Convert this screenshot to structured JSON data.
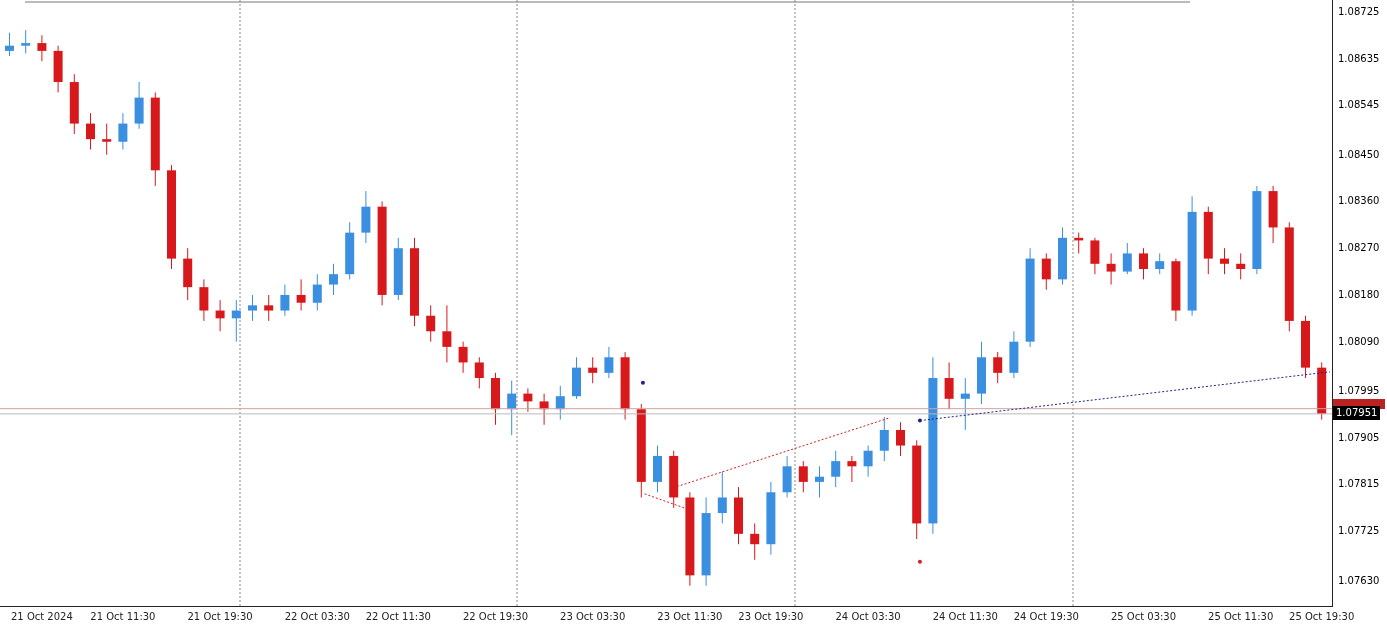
{
  "chart_data": {
    "type": "candlestick",
    "categories": [
      null,
      null,
      "21 Oct 2024",
      null,
      null,
      null,
      null,
      "21 Oct 11:30",
      null,
      null,
      null,
      null,
      null,
      "21 Oct 19:30",
      null,
      null,
      null,
      null,
      null,
      "22 Oct 03:30",
      null,
      null,
      null,
      null,
      "22 Oct 11:30",
      null,
      null,
      null,
      null,
      null,
      "22 Oct 19:30",
      null,
      null,
      null,
      null,
      null,
      "23 Oct 03:30",
      null,
      null,
      null,
      null,
      null,
      "23 Oct 11:30",
      null,
      null,
      null,
      null,
      "23 Oct 19:30",
      null,
      null,
      null,
      null,
      null,
      "24 Oct 03:30",
      null,
      null,
      null,
      null,
      null,
      "24 Oct 11:30",
      null,
      null,
      null,
      null,
      "24 Oct 19:30",
      null,
      null,
      null,
      null,
      null,
      "25 Oct 03:30",
      null,
      null,
      null,
      null,
      null,
      "25 Oct 11:30",
      null,
      null,
      null,
      null,
      "25 Oct 19:30"
    ],
    "ohlc": [
      [
        1.0865,
        1.08685,
        1.0864,
        1.0866
      ],
      [
        1.0866,
        1.0869,
        1.08645,
        1.08665
      ],
      [
        1.08665,
        1.0868,
        1.0863,
        1.0865
      ],
      [
        1.0865,
        1.0866,
        1.0857,
        1.0859
      ],
      [
        1.0859,
        1.08605,
        1.0849,
        1.0851
      ],
      [
        1.0851,
        1.0853,
        1.0846,
        1.0848
      ],
      [
        1.0848,
        1.0851,
        1.0845,
        1.08475
      ],
      [
        1.08475,
        1.0853,
        1.0846,
        1.0851
      ],
      [
        1.0851,
        1.0859,
        1.085,
        1.0856
      ],
      [
        1.0856,
        1.0857,
        1.0839,
        1.0842
      ],
      [
        1.0842,
        1.0843,
        1.0823,
        1.0825
      ],
      [
        1.0825,
        1.0827,
        1.0817,
        1.08195
      ],
      [
        1.08195,
        1.0821,
        1.0813,
        1.0815
      ],
      [
        1.0815,
        1.0817,
        1.0811,
        1.08135
      ],
      [
        1.08135,
        1.0817,
        1.0809,
        1.0815
      ],
      [
        1.0815,
        1.0818,
        1.0813,
        1.0816
      ],
      [
        1.0816,
        1.0818,
        1.0813,
        1.0815
      ],
      [
        1.0815,
        1.082,
        1.0814,
        1.0818
      ],
      [
        1.0818,
        1.0821,
        1.0815,
        1.08165
      ],
      [
        1.08165,
        1.0822,
        1.0815,
        1.082
      ],
      [
        1.082,
        1.0824,
        1.0818,
        1.0822
      ],
      [
        1.0822,
        1.0832,
        1.0821,
        1.083
      ],
      [
        1.083,
        1.0838,
        1.0828,
        1.0835
      ],
      [
        1.0835,
        1.0836,
        1.0816,
        1.0818
      ],
      [
        1.0818,
        1.0829,
        1.0817,
        1.0827
      ],
      [
        1.0827,
        1.0829,
        1.0812,
        1.0814
      ],
      [
        1.0814,
        1.0816,
        1.0809,
        1.0811
      ],
      [
        1.0811,
        1.0816,
        1.0805,
        1.0808
      ],
      [
        1.0808,
        1.0809,
        1.0803,
        1.0805
      ],
      [
        1.0805,
        1.0806,
        1.08,
        1.0802
      ],
      [
        1.0802,
        1.0803,
        1.0793,
        1.0796
      ],
      [
        1.0796,
        1.08015,
        1.0791,
        1.0799
      ],
      [
        1.0799,
        1.08,
        1.07955,
        1.07975
      ],
      [
        1.07975,
        1.0799,
        1.0793,
        1.0796
      ],
      [
        1.0796,
        1.08005,
        1.0794,
        1.07985
      ],
      [
        1.07985,
        1.0806,
        1.0798,
        1.0804
      ],
      [
        1.0804,
        1.0806,
        1.0801,
        1.0803
      ],
      [
        1.0803,
        1.0808,
        1.0802,
        1.0806
      ],
      [
        1.0806,
        1.0807,
        1.0794,
        1.0796
      ],
      [
        1.0796,
        1.0797,
        1.0779,
        1.0782
      ],
      [
        1.0782,
        1.0789,
        1.078,
        1.0787
      ],
      [
        1.0787,
        1.0788,
        1.0777,
        1.0779
      ],
      [
        1.0779,
        1.078,
        1.0762,
        1.0764
      ],
      [
        1.0764,
        1.0779,
        1.0762,
        1.0776
      ],
      [
        1.0776,
        1.0784,
        1.0774,
        1.0779
      ],
      [
        1.0779,
        1.0781,
        1.077,
        1.0772
      ],
      [
        1.0772,
        1.0774,
        1.0767,
        1.077
      ],
      [
        1.077,
        1.0782,
        1.0768,
        1.078
      ],
      [
        1.078,
        1.0787,
        1.0779,
        1.0785
      ],
      [
        1.0785,
        1.0786,
        1.078,
        1.0782
      ],
      [
        1.0782,
        1.0785,
        1.0779,
        1.0783
      ],
      [
        1.0783,
        1.0788,
        1.0781,
        1.0786
      ],
      [
        1.0786,
        1.0787,
        1.0782,
        1.0785
      ],
      [
        1.0785,
        1.0789,
        1.0783,
        1.0788
      ],
      [
        1.0788,
        1.07945,
        1.0786,
        1.0792
      ],
      [
        1.0792,
        1.07935,
        1.0787,
        1.0789
      ],
      [
        1.0789,
        1.079,
        1.0771,
        1.0774
      ],
      [
        1.0774,
        1.0806,
        1.0772,
        1.0802
      ],
      [
        1.0802,
        1.0805,
        1.0796,
        1.0798
      ],
      [
        1.0798,
        1.0802,
        1.0792,
        1.0799
      ],
      [
        1.0799,
        1.0809,
        1.0797,
        1.0806
      ],
      [
        1.0806,
        1.0807,
        1.0801,
        1.0803
      ],
      [
        1.0803,
        1.0811,
        1.0802,
        1.0809
      ],
      [
        1.0809,
        1.0827,
        1.0808,
        1.0825
      ],
      [
        1.0825,
        1.0826,
        1.0819,
        1.0821
      ],
      [
        1.0821,
        1.0831,
        1.082,
        1.0829
      ],
      [
        1.0829,
        1.083,
        1.0826,
        1.08285
      ],
      [
        1.08285,
        1.0829,
        1.0822,
        1.0824
      ],
      [
        1.0824,
        1.0826,
        1.082,
        1.08225
      ],
      [
        1.08225,
        1.0828,
        1.0822,
        1.0826
      ],
      [
        1.0826,
        1.0827,
        1.0821,
        1.0823
      ],
      [
        1.0823,
        1.0826,
        1.0822,
        1.08245
      ],
      [
        1.08245,
        1.0825,
        1.0813,
        1.0815
      ],
      [
        1.0815,
        1.0837,
        1.0814,
        1.0834
      ],
      [
        1.0834,
        1.0835,
        1.0822,
        1.0825
      ],
      [
        1.0825,
        1.0827,
        1.0822,
        1.0824
      ],
      [
        1.0824,
        1.0826,
        1.0821,
        1.0823
      ],
      [
        1.0823,
        1.0839,
        1.0822,
        1.0838
      ],
      [
        1.0838,
        1.0839,
        1.0828,
        1.0831
      ],
      [
        1.0831,
        1.0832,
        1.0811,
        1.0813
      ],
      [
        1.0813,
        1.0814,
        1.0802,
        1.0804
      ],
      [
        1.0804,
        1.0805,
        1.0794,
        1.07951
      ]
    ],
    "yticks": [
      {
        "value": 1.08725,
        "label": "1.08725"
      },
      {
        "value": 1.08635,
        "label": "1.08635"
      },
      {
        "value": 1.08545,
        "label": "1.08545"
      },
      {
        "value": 1.0845,
        "label": "1.08450"
      },
      {
        "value": 1.0836,
        "label": "1.08360"
      },
      {
        "value": 1.0827,
        "label": "1.08270"
      },
      {
        "value": 1.0818,
        "label": "1.08180"
      },
      {
        "value": 1.0809,
        "label": "1.08090"
      },
      {
        "value": 1.07995,
        "label": "1.07995"
      },
      {
        "value": 1.07905,
        "label": "1.07905"
      },
      {
        "value": 1.07815,
        "label": "1.07815"
      },
      {
        "value": 1.07725,
        "label": "1.07725"
      },
      {
        "value": 1.0763,
        "label": "1.07630"
      }
    ],
    "ylim": [
      1.07581,
      1.08748
    ]
  },
  "current_price": {
    "label": "1.07951"
  }
}
